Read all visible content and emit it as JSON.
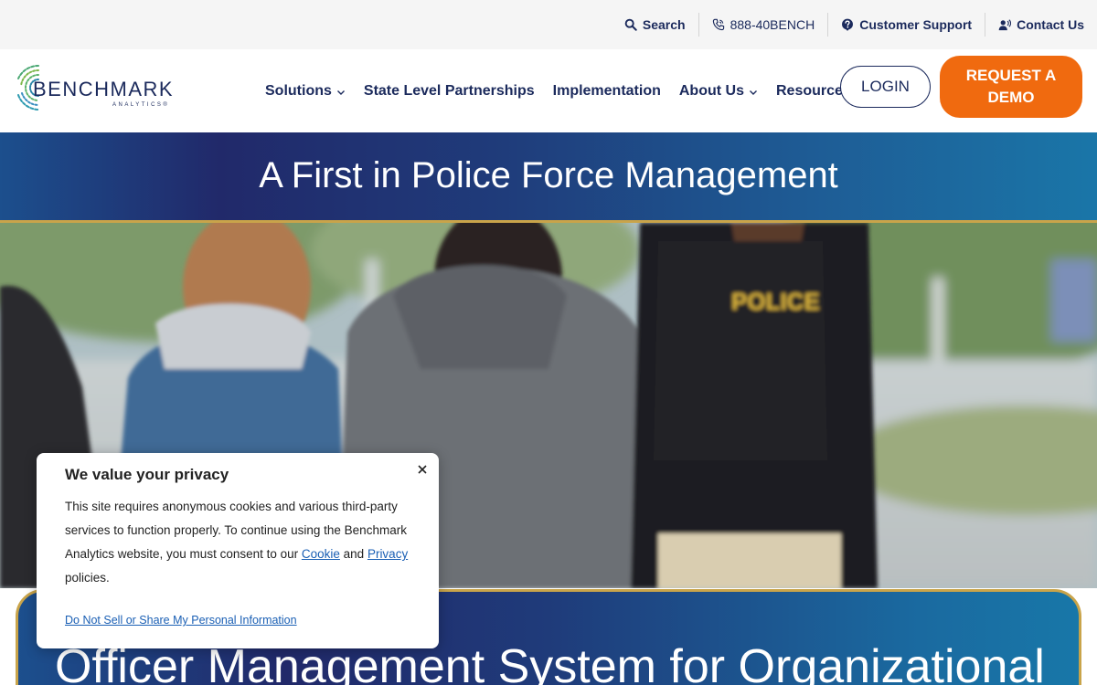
{
  "utility_bar": {
    "search_label": "Search",
    "phone_label": "888-40BENCH",
    "support_label": "Customer Support",
    "contact_label": "Contact Us"
  },
  "logo": {
    "wordmark": "BENCHMARK",
    "sub": "ANALYTICS®"
  },
  "nav": {
    "items": [
      {
        "label": "Solutions",
        "dropdown": true
      },
      {
        "label": "State Level Partnerships",
        "dropdown": false
      },
      {
        "label": "Implementation",
        "dropdown": false
      },
      {
        "label": "About Us",
        "dropdown": true
      },
      {
        "label": "Resources",
        "dropdown": true
      }
    ],
    "login_label": "LOGIN",
    "demo_label_line1": "REQUEST A",
    "demo_label_line2": "DEMO"
  },
  "hero": {
    "title": "A First in Police Force Management",
    "vest_text": "POLICE"
  },
  "card": {
    "title": "Officer Management System for Organizational"
  },
  "privacy": {
    "title": "We value your privacy",
    "body_start": "This site requires anonymous cookies and various third-party services to function properly. To continue using the Benchmark Analytics website, you must consent to our ",
    "cookie_link": "Cookie",
    "and_text": " and ",
    "privacy_link": "Privacy",
    "body_end": " policies.",
    "optout_link": "Do Not Sell or Share My Personal Information"
  },
  "colors": {
    "navy": "#1b2a5c",
    "orange": "#f06a0f",
    "gold": "#c9a44a",
    "link_blue": "#1a5fb4",
    "utility_bg": "#f5f5f5"
  },
  "icons": [
    "search-icon",
    "phone-icon",
    "question-icon",
    "contact-icon",
    "chevron-down-icon",
    "close-icon",
    "logo-circle-icon"
  ]
}
